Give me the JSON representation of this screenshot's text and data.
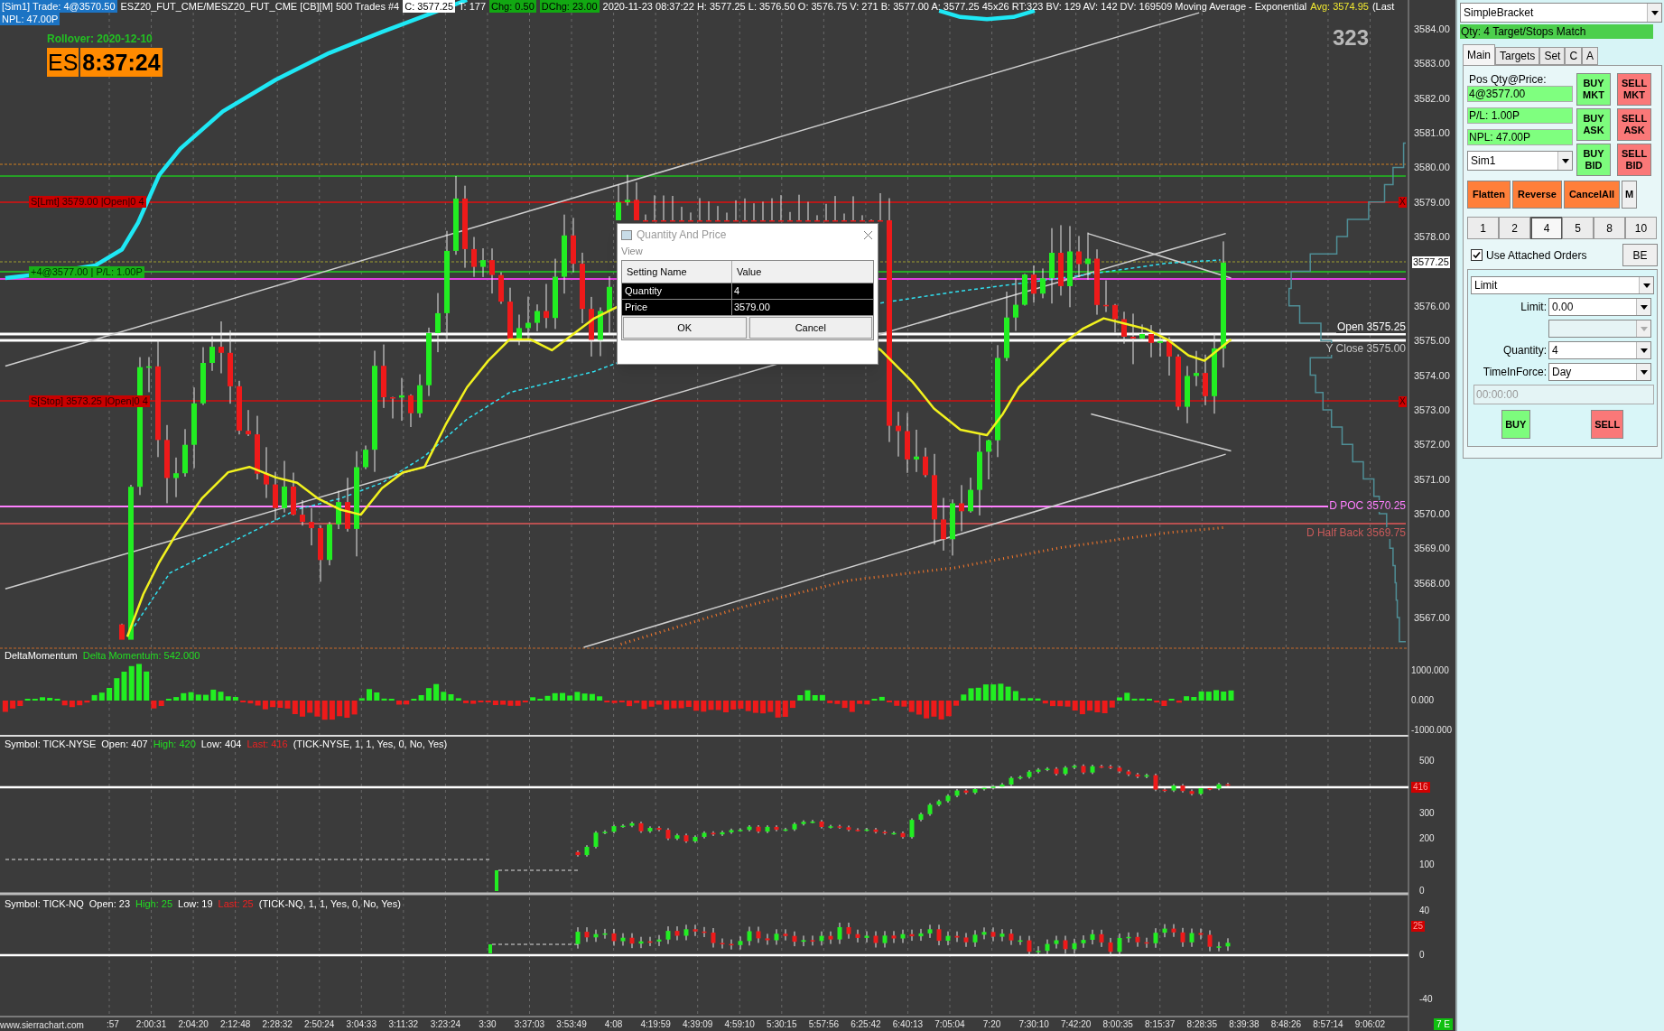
{
  "chart_header": {
    "segments": [
      {
        "text": "[Sim1]  Trade: 4@3570.50",
        "kind": "account"
      },
      {
        "text": "ESZ20_FUT_CME/MESZ20_FUT_CME [CB][M]  500 Trades  #4",
        "kind": "plain"
      },
      {
        "text": "C: 3577.25",
        "kind": "price"
      },
      {
        "text": "T: 177",
        "kind": "plain"
      },
      {
        "text": "Chg: 0.50",
        "kind": "change"
      },
      {
        "text": "DChg: 23.00",
        "kind": "change"
      },
      {
        "text": "2020-11-23 08:37:22 H: 3577.25 L: 3576.50 O: 3576.75 V: 271 B: 3577.00 A: 3577.25 45x26 RT:323 BV: 129 AV: 142 DV: 169509 Moving Average - Exponential",
        "kind": "plain"
      },
      {
        "text": "Avg: 3574.95",
        "kind": "average"
      },
      {
        "text": "(Last",
        "kind": "plain"
      }
    ],
    "second_line": "NPL: 47.00P"
  },
  "rollover": "Rollover: 2020-12-10",
  "clock": {
    "symbol": "ES",
    "time": "8:37:24"
  },
  "bar_counter": "323",
  "order_labels": [
    {
      "text": "S[Lmt] 3579.00 |Open|0 4",
      "kind": "sell",
      "cancel_mark": "X"
    },
    {
      "text": "+4@3577.00 | P/L: 1.00P",
      "kind": "position"
    },
    {
      "text": "S[Stop] 3573.25 |Open|0 4",
      "kind": "sell",
      "cancel_mark": "X"
    }
  ],
  "level_labels": [
    {
      "text": "Open 3575.25",
      "kind": "open"
    },
    {
      "text": "Y Close 3575.00",
      "kind": "close"
    },
    {
      "text": "D POC 3570.25",
      "kind": "poc"
    },
    {
      "text": "D Half Back 3569.75",
      "kind": "half_back"
    }
  ],
  "price_axis": {
    "labels": [
      "3584.00",
      "3583.00",
      "3582.00",
      "3581.00",
      "3580.00",
      "3579.00",
      "3578.00",
      "3576.00",
      "3575.00",
      "3574.00",
      "3573.00",
      "3572.00",
      "3571.00",
      "3570.00",
      "3569.00",
      "3568.00",
      "3567.00"
    ],
    "current": "3577.25"
  },
  "delta_panel": {
    "name": "DeltaMomentum",
    "study": "Delta Momentum: 542.000",
    "axis": [
      "1000.000",
      "0.000",
      "-1000.000"
    ]
  },
  "tick_nyse": {
    "segments": [
      {
        "text": "Symbol: TICK-NYSE",
        "kind": "plain"
      },
      {
        "text": "Open: 407",
        "kind": "plain"
      },
      {
        "text": "High: 420",
        "kind": "high"
      },
      {
        "text": "Low: 404",
        "kind": "plain"
      },
      {
        "text": "Last: 416",
        "kind": "last"
      },
      {
        "text": "(TICK-NYSE, 1, 1, Yes, 0, No, Yes)",
        "kind": "plain"
      }
    ],
    "axis": [
      "500",
      "300",
      "200",
      "100",
      "0"
    ],
    "last_marker": "416"
  },
  "tick_nq": {
    "segments": [
      {
        "text": "Symbol: TICK-NQ",
        "kind": "plain"
      },
      {
        "text": "Open: 23",
        "kind": "plain"
      },
      {
        "text": "High: 25",
        "kind": "high"
      },
      {
        "text": "Low: 19",
        "kind": "plain"
      },
      {
        "text": "Last: 25",
        "kind": "last"
      },
      {
        "text": "(TICK-NQ, 1, 1, Yes, 0, No, Yes)",
        "kind": "plain"
      }
    ],
    "axis": [
      "40",
      "0",
      "-40"
    ],
    "last_marker": "25"
  },
  "time_axis": {
    "site": "www.sierrachart.com",
    "labels": [
      ":57",
      "2:00:31",
      "2:04:20",
      "2:12:48",
      "2:28:32",
      "2:50:24",
      "3:04:33",
      "3:11:32",
      "3:23:24",
      "3:30",
      "3:37:03",
      "3:53:49",
      "4:08",
      "4:19:59",
      "4:39:09",
      "4:59:10",
      "5:30:15",
      "5:57:56",
      "6:25:42",
      "6:40:13",
      "7:05:04",
      "7:20",
      "7:30:10",
      "7:42:20",
      "8:00:35",
      "8:15:37",
      "8:28:35",
      "8:39:38",
      "8:48:26",
      "8:57:14",
      "9:06:02"
    ]
  },
  "status_badge": "7 E",
  "dialog": {
    "title": "Quantity And Price",
    "section": "View",
    "columns": [
      "Setting Name",
      "Value"
    ],
    "rows": [
      {
        "name": "Quantity",
        "value": "4"
      },
      {
        "name": "Price",
        "value": "3579.00"
      }
    ],
    "buttons": [
      "OK",
      "Cancel"
    ]
  },
  "trade_panel": {
    "strategy": "SimpleBracket",
    "status": "Qty: 4 Target/Stops Match",
    "tabs": [
      {
        "label": "Main",
        "selected": true
      },
      {
        "label": "Targets",
        "selected": false
      },
      {
        "label": "Set",
        "selected": false
      },
      {
        "label": "C",
        "selected": false
      },
      {
        "label": "A",
        "selected": false
      }
    ],
    "position_label": "Pos Qty@Price:",
    "position_value": "4@3577.00",
    "pl": "P/L: 1.00P",
    "npl": "NPL: 47.00P",
    "account": "Sim1",
    "order_buttons": [
      {
        "label": "BUY MKT",
        "kind": "buy"
      },
      {
        "label": "SELL MKT",
        "kind": "sell"
      },
      {
        "label": "BUY ASK",
        "kind": "buy"
      },
      {
        "label": "SELL ASK",
        "kind": "sell"
      },
      {
        "label": "BUY BID",
        "kind": "buy"
      },
      {
        "label": "SELL BID",
        "kind": "sell"
      }
    ],
    "action_buttons": [
      {
        "label": "Flatten",
        "kind": "action"
      },
      {
        "label": "Reverse",
        "kind": "action"
      },
      {
        "label": "CancelAll",
        "kind": "action"
      },
      {
        "label": "M",
        "kind": "plain"
      }
    ],
    "quantity_buttons": [
      {
        "label": "1",
        "selected": false
      },
      {
        "label": "2",
        "selected": false
      },
      {
        "label": "4",
        "selected": true
      },
      {
        "label": "5",
        "selected": false
      },
      {
        "label": "8",
        "selected": false
      },
      {
        "label": "10",
        "selected": false
      }
    ],
    "attached_orders": {
      "label": "Use Attached Orders",
      "checked": true
    },
    "be_button": "BE",
    "order_type": "Limit",
    "limit_label": "Limit:",
    "limit_value": "0.00",
    "quantity_label": "Quantity:",
    "quantity_value": "4",
    "tif_label": "TimeInForce:",
    "tif_value": "Day",
    "expiry_time": "00:00:00",
    "buy_button": "BUY",
    "sell_button": "SELL"
  }
}
